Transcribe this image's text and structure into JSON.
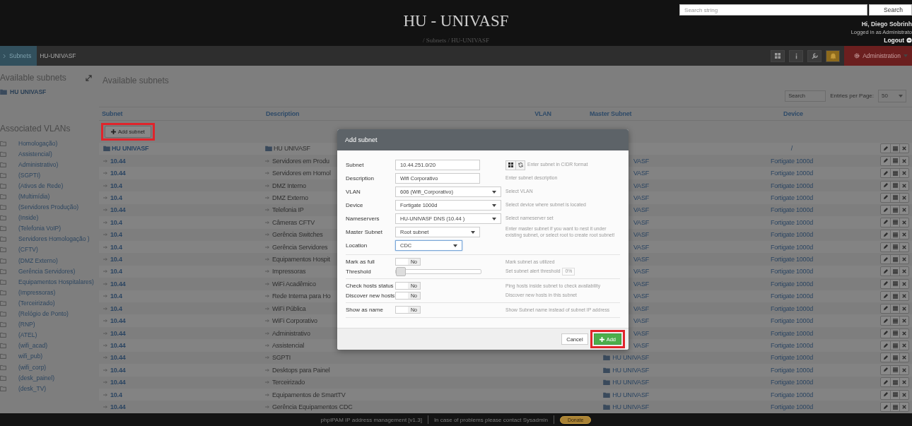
{
  "header": {
    "title": "HU - UNIVASF",
    "breadcrumb": "/ Subnets / HU-UNIVASF",
    "search": {
      "placeholder": "Search string",
      "button": "Search"
    },
    "user": {
      "greeting": "Hi, Diego Sobrinh",
      "role": "Logged in as Administrato",
      "logout": "Logout"
    }
  },
  "navbar": {
    "items": [
      {
        "label": "Subnets",
        "selected": true
      },
      {
        "label": "HU-UNIVASF",
        "selected": false
      }
    ],
    "admin": "Administration"
  },
  "sidebar": {
    "title": "Available subnets",
    "root": "HU UNIVASF",
    "vlans_title": "Associated VLANs",
    "vlans": [
      "Homologação)",
      "Assistencial)",
      "Administrativo)",
      "(SGPTI)",
      "(Ativos de Rede)",
      "(Multimídia)",
      "(Servidores Produção)",
      "(Inside)",
      "(Telefonia VoIP)",
      "Servidores Homologação )",
      "(CFTV)",
      "(DMZ Externo)",
      "Gerência Servidores)",
      "Equipamentos Hospitalares)",
      "(Impressoras)",
      "(Terceirizado)",
      "(Relógio de Ponto)",
      "(RNP)",
      "(ATEL)",
      "(wifi_acad)",
      "wifi_pub)",
      "(wifi_corp)",
      "(desk_painel)",
      "(desk_TV)"
    ]
  },
  "main": {
    "title": "Available subnets",
    "search_placeholder": "Search",
    "entries_label": "Entries per Page:",
    "entries_value": "50",
    "add_button": "Add subnet",
    "columns": [
      "Subnet",
      "Description",
      "VLAN",
      "Master Subnet",
      "Device"
    ],
    "root_row": {
      "subnet": "HU UNIVASF",
      "description": "HU UNIVASF",
      "device": "/"
    },
    "rows": [
      {
        "subnet": "10.44",
        "description": "Servidores em Produ",
        "master": {
          "kind": "plain",
          "text": "VASF"
        },
        "device": "Fortigate 1000d"
      },
      {
        "subnet": "10.44",
        "description": "Servidores em Homol",
        "master": {
          "kind": "plain",
          "text": "VASF"
        },
        "device": "Fortigate 1000d"
      },
      {
        "subnet": "10.4",
        "description": "DMZ Interno",
        "master": {
          "kind": "plain",
          "text": "VASF"
        },
        "device": "Fortigate 1000d"
      },
      {
        "subnet": "10.4",
        "description": "DMZ Externo",
        "master": {
          "kind": "plain",
          "text": "VASF"
        },
        "device": "Fortigate 1000d"
      },
      {
        "subnet": "10.44",
        "description": "Telefonia IP",
        "master": {
          "kind": "plain",
          "text": "VASF"
        },
        "device": "Fortigate 1000d"
      },
      {
        "subnet": "10.4",
        "description": "Câmeras CFTV",
        "master": {
          "kind": "plain",
          "text": "VASF"
        },
        "device": "Fortigate 1000d"
      },
      {
        "subnet": "10.4",
        "description": "Gerência Switches",
        "master": {
          "kind": "plain",
          "text": "VASF"
        },
        "device": "Fortigate 1000d"
      },
      {
        "subnet": "10.4",
        "description": "Gerência Servidores",
        "master": {
          "kind": "plain",
          "text": "VASF"
        },
        "device": "Fortigate 1000d"
      },
      {
        "subnet": "10.4",
        "description": "Equipamentos Hospit",
        "master": {
          "kind": "plain",
          "text": "VASF"
        },
        "device": "Fortigate 1000d"
      },
      {
        "subnet": "10.4",
        "description": "Impressoras",
        "master": {
          "kind": "plain",
          "text": "VASF"
        },
        "device": "Fortigate 1000d"
      },
      {
        "subnet": "10.44",
        "description": "WiFi Acadêmico",
        "master": {
          "kind": "plain",
          "text": "VASF"
        },
        "device": "Fortigate 1000d"
      },
      {
        "subnet": "10.4",
        "description": "Rede Interna para Ho",
        "master": {
          "kind": "plain",
          "text": "VASF"
        },
        "device": "Fortigate 1000d"
      },
      {
        "subnet": "10.4",
        "description": "WiFi Pública",
        "master": {
          "kind": "plain",
          "text": "VASF"
        },
        "device": "Fortigate 1000d"
      },
      {
        "subnet": "10.44",
        "description": "WiFi Corporativo",
        "master": {
          "kind": "plain",
          "text": "VASF"
        },
        "device": "Fortigate 1000d"
      },
      {
        "subnet": "10.44",
        "description": "Administrativo",
        "master": {
          "kind": "plain",
          "text": "VASF"
        },
        "device": "Fortigate 1000d"
      },
      {
        "subnet": "10.44",
        "description": "Assistencial",
        "master": {
          "kind": "plain",
          "text": "VASF"
        },
        "device": "Fortigate 1000d"
      },
      {
        "subnet": "10.44",
        "description": "SGPTI",
        "master": {
          "kind": "folder",
          "text": "HU UNIVASF"
        },
        "device": "Fortigate 1000d"
      },
      {
        "subnet": "10.44",
        "description": "Desktops para Painel",
        "master": {
          "kind": "folder",
          "text": "HU UNIVASF"
        },
        "device": "Fortigate 1000d"
      },
      {
        "subnet": "10.44",
        "description": "Terceirizado",
        "master": {
          "kind": "folder",
          "text": "HU UNIVASF"
        },
        "device": "Fortigate 1000d"
      },
      {
        "subnet": "10.4",
        "description": "Equipamentos de SmartTV",
        "master": {
          "kind": "folder",
          "text": "HU UNIVASF"
        },
        "device": "Fortigate 1000d"
      },
      {
        "subnet": "10.44",
        "description": "Gerência Equipamentos CDC",
        "master": {
          "kind": "folder",
          "text": "HU UNIVASF"
        },
        "device": "Fortigate 1000d"
      }
    ]
  },
  "modal": {
    "title": "Add subnet",
    "sections": [
      [
        {
          "kind": "text",
          "label": "Subnet",
          "value": "10.44.251.0/20",
          "focused": false,
          "tools": true,
          "help": "Enter subnet in CIDR format"
        },
        {
          "kind": "text",
          "label": "Description",
          "value": "Wifi Corporativo",
          "focused": false,
          "help": "Enter subnet description"
        },
        {
          "kind": "select",
          "label": "VLAN",
          "value": "606 (Wifi_Corporativo)",
          "focused": false,
          "help": "Select VLAN"
        },
        {
          "kind": "select",
          "label": "Device",
          "value": "Fortigate 1000d",
          "focused": false,
          "help": "Select device where subnet is located"
        },
        {
          "kind": "select",
          "label": "Nameservers",
          "value": "HU-UNIVASF DNS (10.44 )",
          "focused": false,
          "help": "Select nameserver set"
        },
        {
          "kind": "select",
          "label": "Master Subnet",
          "value": "Root subnet",
          "focused": false,
          "help": "Enter master subnet if you want to nest it under existing subnet, or select root to create root subnet!"
        },
        {
          "kind": "select",
          "label": "Location",
          "value": "CDC",
          "focused": true
        }
      ],
      [
        {
          "kind": "toggle",
          "label": "Mark as full",
          "on": false,
          "text": "No",
          "help": "Mark subnet as utilized"
        },
        {
          "kind": "slider",
          "label": "Threshold",
          "level": 0,
          "help": "Set subnet alert threshold",
          "reading": "0%"
        }
      ],
      [
        {
          "kind": "toggle",
          "label": "Check hosts status",
          "on": false,
          "text": "No",
          "help": "Ping hosts inside subnet to check availability"
        },
        {
          "kind": "toggle",
          "label": "Discover new hosts",
          "on": false,
          "text": "No",
          "help": "Discover new hosts in this subnet"
        }
      ],
      [
        {
          "kind": "toggle",
          "label": "Show as name",
          "on": false,
          "text": "No",
          "help": "Show Subnet name instead of subnet IP address"
        }
      ]
    ],
    "cancel": "Cancel",
    "add": "Add"
  },
  "footer": {
    "text": "phpIPAM IP address management [v1.3]",
    "contact": "In case of problems please contact Sysadmin",
    "donate": "Donate"
  }
}
